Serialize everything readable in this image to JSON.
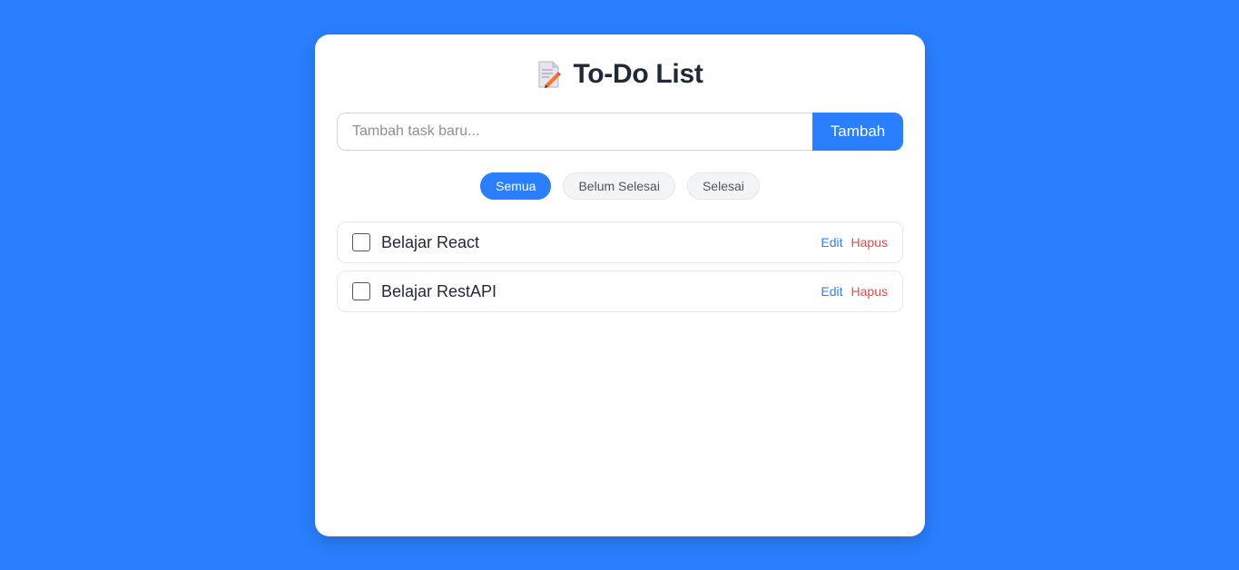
{
  "header": {
    "icon": "memo-pencil-icon",
    "title": "To-Do List"
  },
  "add_form": {
    "placeholder": "Tambah task baru...",
    "input_value": "",
    "button_label": "Tambah"
  },
  "filters": [
    {
      "label": "Semua",
      "active": true
    },
    {
      "label": "Belum Selesai",
      "active": false
    },
    {
      "label": "Selesai",
      "active": false
    }
  ],
  "tasks": [
    {
      "text": "Belajar React",
      "done": false,
      "edit_label": "Edit",
      "delete_label": "Hapus"
    },
    {
      "text": "Belajar RestAPI",
      "done": false,
      "edit_label": "Edit",
      "delete_label": "Hapus"
    }
  ],
  "colors": {
    "background": "#2a7fff",
    "accent": "#2a7fff",
    "danger": "#ef4444",
    "card": "#ffffff"
  }
}
